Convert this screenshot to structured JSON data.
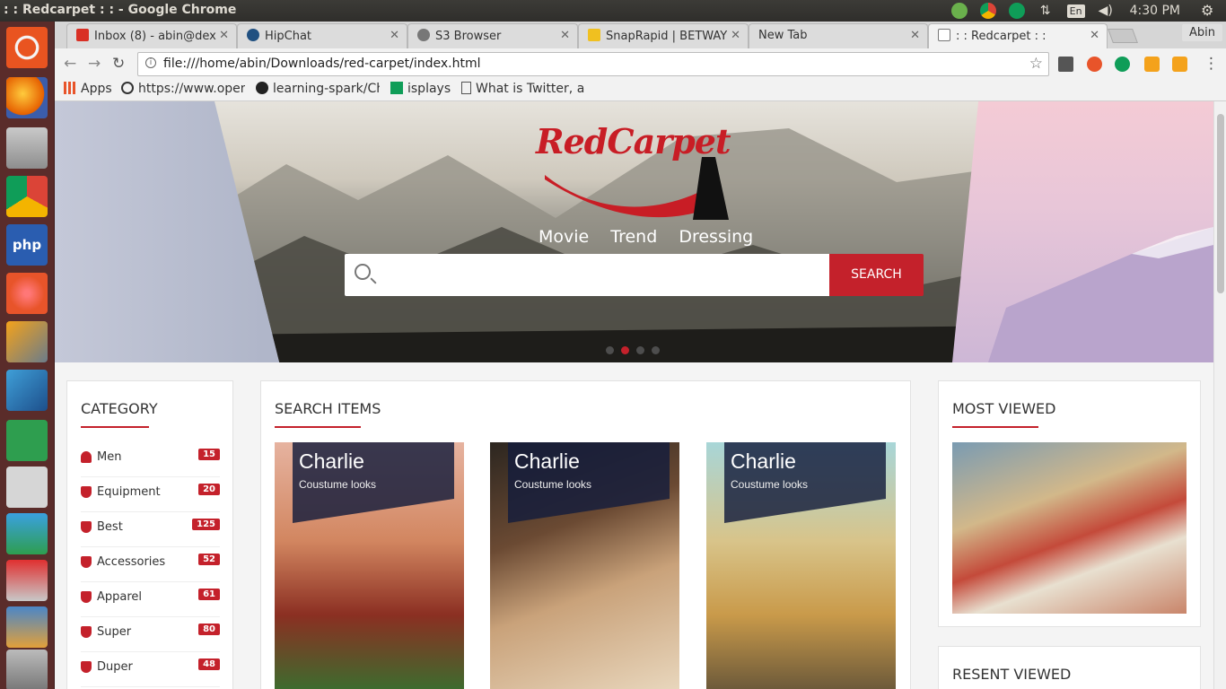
{
  "os": {
    "window_title": ": : Redcarpet : : - Google Chrome",
    "keyboard_layout": "En",
    "clock": "4:30 PM",
    "user": "Abin"
  },
  "browser": {
    "tabs": [
      {
        "label": "Inbox (8) - abin@dex",
        "icon": "gmail-icon",
        "active": false
      },
      {
        "label": "HipChat",
        "icon": "hipchat-icon",
        "active": false
      },
      {
        "label": "S3 Browser",
        "icon": "s3-icon",
        "active": false
      },
      {
        "label": "SnapRapid | BETWAY",
        "icon": "snaprapid-icon",
        "active": false
      },
      {
        "label": "New Tab",
        "icon": "",
        "active": false
      },
      {
        "label": ": : Redcarpet : :",
        "icon": "page-icon",
        "active": true
      }
    ],
    "url": "file:///home/abin/Downloads/red-carpet/index.html",
    "bookmarks": [
      {
        "label": "Apps",
        "icon": "apps-grid-icon"
      },
      {
        "label": "https://www.open",
        "icon": "eye-icon"
      },
      {
        "label": "learning-spark/Cha",
        "icon": "github-icon"
      },
      {
        "label": "isplays",
        "icon": "sheets-icon"
      },
      {
        "label": "What is Twitter, a",
        "icon": "page-icon"
      }
    ]
  },
  "site": {
    "logo": {
      "part1": "Red",
      "part2": "Carpet"
    },
    "nav": [
      "Movie",
      "Trend",
      "Dressing"
    ],
    "search": {
      "placeholder": "",
      "button": "SEARCH"
    },
    "slider": {
      "count": 4,
      "active": 2
    },
    "category": {
      "title": "CATEGORY",
      "items": [
        {
          "label": "Men",
          "count": "15",
          "icon": "user-icon"
        },
        {
          "label": "Equipment",
          "count": "20",
          "icon": "shield-icon"
        },
        {
          "label": "Best",
          "count": "125",
          "icon": "shield-icon"
        },
        {
          "label": "Accessories",
          "count": "52",
          "icon": "shield-icon"
        },
        {
          "label": "Apparel",
          "count": "61",
          "icon": "shield-icon"
        },
        {
          "label": "Super",
          "count": "80",
          "icon": "shield-icon"
        },
        {
          "label": "Duper",
          "count": "48",
          "icon": "shield-icon"
        }
      ]
    },
    "search_items": {
      "title": "SEARCH ITEMS",
      "cards": [
        {
          "name": "Charlie",
          "subtitle": "Coustume looks",
          "bg": "#c96b45"
        },
        {
          "name": "Charlie",
          "subtitle": "Coustume looks",
          "bg": "#b88a5a"
        },
        {
          "name": "Charlie",
          "subtitle": "Coustume looks",
          "bg": "#c9a76a"
        }
      ]
    },
    "most_viewed": {
      "title": "MOST VIEWED"
    },
    "recent_viewed": {
      "title": "RESENT VIEWED"
    }
  },
  "colors": {
    "accent": "#c4212b",
    "launcher": "#5a2c2a"
  }
}
